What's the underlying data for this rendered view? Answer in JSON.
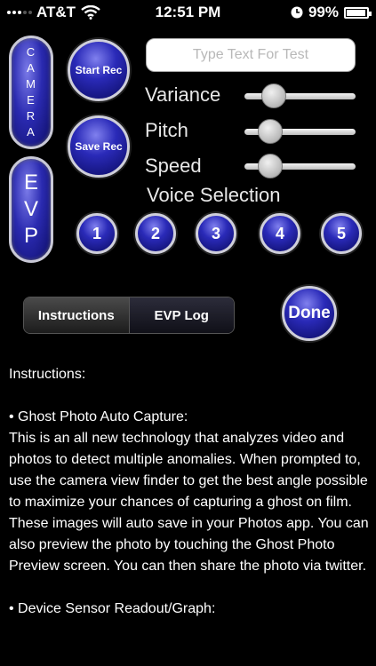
{
  "status_bar": {
    "carrier": "AT&T",
    "time": "12:51 PM",
    "battery": "99%"
  },
  "buttons": {
    "camera_letters": [
      "C",
      "A",
      "M",
      "E",
      "R",
      "A"
    ],
    "evp_letters": [
      "E",
      "V",
      "P"
    ],
    "start_rec": "Start Rec",
    "save_rec": "Save Rec",
    "done": "Done"
  },
  "test_input": {
    "placeholder": "Type Text For Test",
    "value": ""
  },
  "sliders": {
    "variance": {
      "label": "Variance",
      "value": 0.2
    },
    "pitch": {
      "label": "Pitch",
      "value": 0.15
    },
    "speed": {
      "label": "Speed",
      "value": 0.15
    }
  },
  "voice_selection": {
    "label": "Voice Selection",
    "options": [
      "1",
      "2",
      "3",
      "4",
      "5"
    ]
  },
  "segments": {
    "instructions": "Instructions",
    "evp_log": "EVP Log",
    "selected": "Instructions"
  },
  "instructions": {
    "heading": "Instructions:",
    "section1_title": "• Ghost Photo Auto Capture:",
    "section1_body": "This is an all new technology that analyzes video and photos to detect multiple anomalies. When prompted to, use the camera view finder to get the best angle possible to maximize your chances of capturing a ghost on film. These images will auto save in your Photos app. You can also preview the photo by touching the Ghost Photo Preview screen. You can then share the photo via twitter.",
    "section2_title": "• Device Sensor Readout/Graph:"
  },
  "colors": {
    "background": "#000000",
    "button_blue": "#2a2ab0",
    "button_rim": "#c9c9d6"
  },
  "icons": [
    "signal-icon",
    "wifi-icon",
    "clock-icon",
    "battery-icon"
  ]
}
